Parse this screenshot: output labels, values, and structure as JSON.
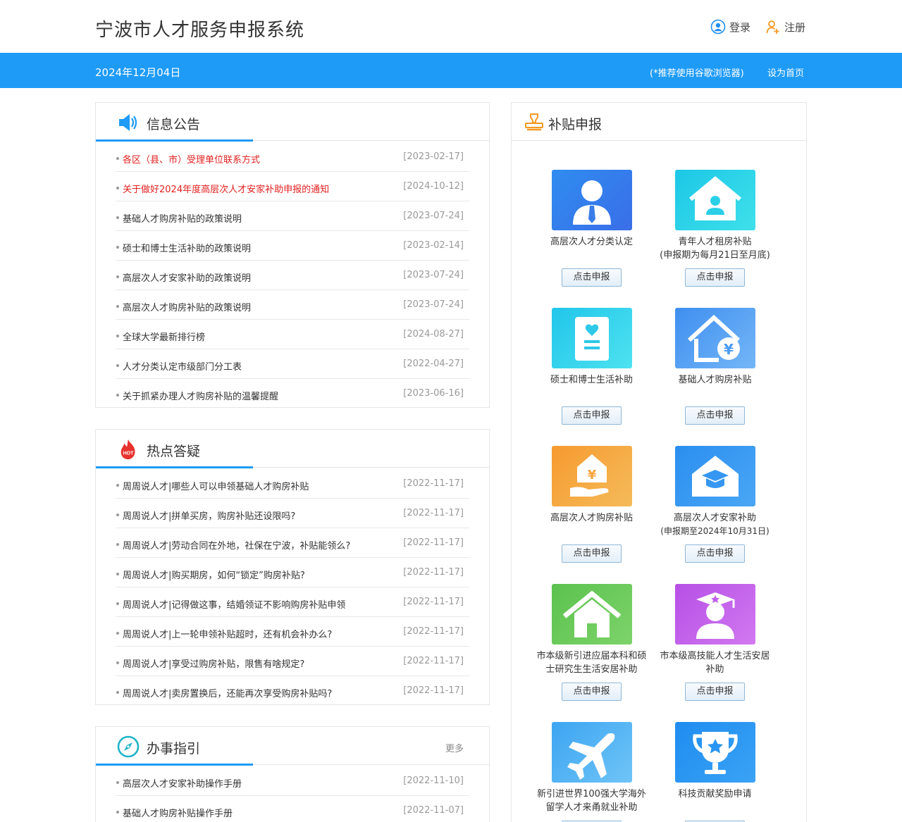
{
  "header": {
    "title": "宁波市人才服务申报系统",
    "login_label": "登录",
    "register_label": "注册"
  },
  "bar": {
    "date": "2024年12月04日",
    "browser_tip": "(*推荐使用谷歌浏览器)",
    "set_home": "设为首页"
  },
  "announcements": {
    "title": "信息公告",
    "items": [
      {
        "text": "各区（县、市）受理单位联系方式",
        "date": "[2023-02-17]"
      },
      {
        "text": "关于做好2024年度高层次人才安家补助申报的通知",
        "date": "[2024-10-12]"
      },
      {
        "text": "基础人才购房补贴的政策说明",
        "date": "[2023-07-24]"
      },
      {
        "text": "硕士和博士生活补助的政策说明",
        "date": "[2023-02-14]"
      },
      {
        "text": "高层次人才安家补助的政策说明",
        "date": "[2023-07-24]"
      },
      {
        "text": "高层次人才购房补贴的政策说明",
        "date": "[2023-07-24]"
      },
      {
        "text": "全球大学最新排行榜",
        "date": "[2024-08-27]"
      },
      {
        "text": "人才分类认定市级部门分工表",
        "date": "[2022-04-27]"
      },
      {
        "text": "关于抓紧办理人才购房补贴的温馨提醒",
        "date": "[2023-06-16]"
      }
    ]
  },
  "hot": {
    "title": "热点答疑",
    "badge": "HOT",
    "items": [
      {
        "text": "周周说人才|哪些人可以申领基础人才购房补贴",
        "date": "[2022-11-17]"
      },
      {
        "text": "周周说人才|拼单买房，购房补贴还设限吗?",
        "date": "[2022-11-17]"
      },
      {
        "text": "周周说人才|劳动合同在外地，社保在宁波，补贴能领么?",
        "date": "[2022-11-17]"
      },
      {
        "text": "周周说人才|购买期房，如何“锁定”购房补贴?",
        "date": "[2022-11-17]"
      },
      {
        "text": "周周说人才|记得做这事，结婚领证不影响购房补贴申领",
        "date": "[2022-11-17]"
      },
      {
        "text": "周周说人才|上一轮申领补贴超时，还有机会补办么?",
        "date": "[2022-11-17]"
      },
      {
        "text": "周周说人才|享受过购房补贴，限售有啥规定?",
        "date": "[2022-11-17]"
      },
      {
        "text": "周周说人才|卖房置换后，还能再次享受购房补贴吗?",
        "date": "[2022-11-17]"
      }
    ]
  },
  "guide": {
    "title": "办事指引",
    "more": "更多",
    "items": [
      {
        "text": "高层次人才安家补助操作手册",
        "date": "[2022-11-10]"
      },
      {
        "text": "基础人才购房补贴操作手册",
        "date": "[2022-11-07]"
      }
    ]
  },
  "subsidy": {
    "title": "补贴申报",
    "button_label": "点击申报",
    "items": [
      {
        "name_line1": "高层次人才分类认定",
        "name_line2": "",
        "icon": "person-tie-icon",
        "color_from": "#2f8cf0",
        "color_to": "#3a6ee8"
      },
      {
        "name_line1": "青年人才租房补贴",
        "name_line2": "(申报期为每月21日至月底)",
        "icon": "house-person-icon",
        "color_from": "#1cc7e6",
        "color_to": "#3fe0ea"
      },
      {
        "name_line1": "硕士和博士生活补助",
        "name_line2": "",
        "icon": "certificate-icon",
        "color_from": "#21c6ea",
        "color_to": "#4ee2f0"
      },
      {
        "name_line1": "基础人才购房补贴",
        "name_line2": "",
        "icon": "house-yuan-icon",
        "color_from": "#3f8ff0",
        "color_to": "#74b6f7"
      },
      {
        "name_line1": "高层次人才购房补贴",
        "name_line2": "",
        "icon": "hand-house-icon",
        "color_from": "#f69a2f",
        "color_to": "#f5bb5a"
      },
      {
        "name_line1": "高层次人才安家补助",
        "name_line2": "(申报期至2024年10月31日)",
        "icon": "house-graduate-icon",
        "color_from": "#2b8ef0",
        "color_to": "#4aa7f5"
      },
      {
        "name_line1": "市本级新引进应届本科和硕",
        "name_line2": "士研究生生活安居补助",
        "icon": "home-icon",
        "color_from": "#5bc24e",
        "color_to": "#7dd36a"
      },
      {
        "name_line1": "市本级高技能人才生活安居",
        "name_line2": "补助",
        "icon": "graduate-person-icon",
        "color_from": "#b64fe6",
        "color_to": "#d279f0"
      },
      {
        "name_line1": "新引进世界100强大学海外",
        "name_line2": "留学人才来甬就业补助",
        "icon": "airplane-icon",
        "color_from": "#3da5f2",
        "color_to": "#6fc4f6"
      },
      {
        "name_line1": "科技贡献奖励申请",
        "name_line2": "",
        "icon": "trophy-icon",
        "color_from": "#1f8cf0",
        "color_to": "#3aa3f5"
      }
    ]
  }
}
